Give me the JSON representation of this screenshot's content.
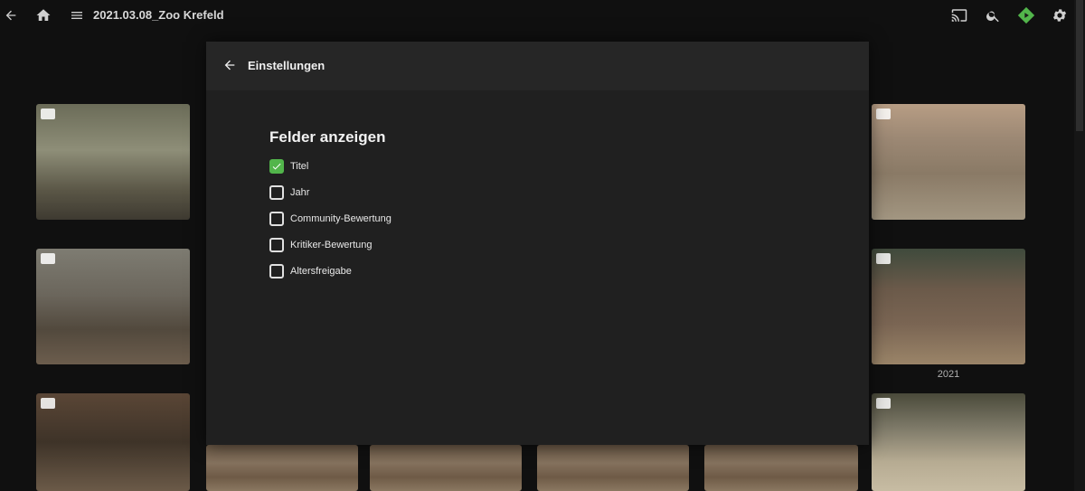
{
  "header": {
    "title": "2021.03.08_Zoo Krefeld",
    "icons": [
      "back-arrow-icon",
      "home-icon",
      "menu-icon",
      "cast-icon",
      "search-icon",
      "play-diamond-icon",
      "settings-gear-icon"
    ],
    "accent_color": "#52b54b"
  },
  "grid": {
    "tiles": [
      {
        "badge": "video-icon"
      },
      {
        "badge": "video-icon"
      },
      {
        "badge": "image-icon"
      },
      {
        "badge": "image-icon"
      },
      {
        "badge": "video-icon"
      },
      {
        "badge": "image-icon"
      }
    ],
    "caption": "2021"
  },
  "dialog": {
    "title": "Einstellungen",
    "section_title": "Felder anzeigen",
    "options": [
      {
        "label": "Titel",
        "checked": true
      },
      {
        "label": "Jahr",
        "checked": false
      },
      {
        "label": "Community-Bewertung",
        "checked": false
      },
      {
        "label": "Kritiker-Bewertung",
        "checked": false
      },
      {
        "label": "Altersfreigabe",
        "checked": false
      }
    ]
  }
}
